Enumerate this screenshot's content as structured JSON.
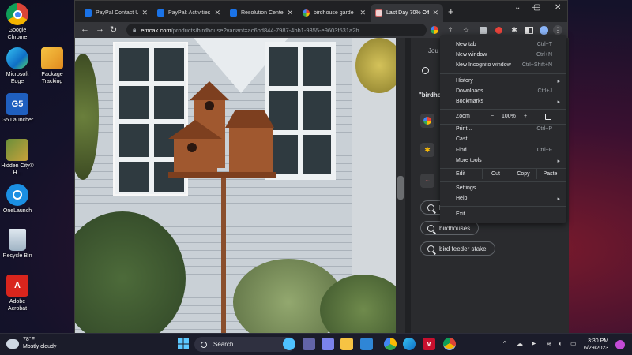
{
  "desktop": {
    "icons": [
      {
        "label": "Google Chrome",
        "icon": "chrome-icon"
      },
      {
        "label": "Microsoft Edge",
        "icon": "edge-icon"
      },
      {
        "label": "G5 Launcher",
        "icon": "g5-launcher-icon"
      },
      {
        "label": "Hidden City® H...",
        "icon": "hidden-city-icon"
      },
      {
        "label": "OneLaunch",
        "icon": "onelaunch-icon"
      },
      {
        "label": "Recycle Bin",
        "icon": "recycle-bin-icon"
      },
      {
        "label": "Adobe Acrobat",
        "icon": "acrobat-icon"
      },
      {
        "label": "Package Tracking",
        "icon": "package-tracking-icon"
      }
    ]
  },
  "browser": {
    "tabs": [
      {
        "title": "PayPal Contact Us",
        "icon": "paypal-icon"
      },
      {
        "title": "PayPal: Activities",
        "icon": "paypal-icon"
      },
      {
        "title": "Resolution Center",
        "icon": "paypal-icon"
      },
      {
        "title": "birdhouse garde",
        "icon": "google-icon"
      },
      {
        "title": "Last Day 70% Off",
        "icon": "site-icon"
      }
    ],
    "url_host": "emcak.com",
    "url_rest": "/products/birdhouse?variant=ac6bd844-7987-4bb1-9355-e9603f531a2b",
    "window_controls": {
      "minimize": "—",
      "maximize": "▢",
      "close": "✕"
    }
  },
  "side_panel": {
    "header_text": "Jou",
    "query_text": "\"birdho",
    "suggestions": [
      "b",
      "birdhouses",
      "bird feeder stake"
    ]
  },
  "menu": {
    "items": [
      {
        "label": "New tab",
        "shortcut": "Ctrl+T"
      },
      {
        "label": "New window",
        "shortcut": "Ctrl+N"
      },
      {
        "label": "New Incognito window",
        "shortcut": "Ctrl+Shift+N"
      },
      {
        "label": "History",
        "shortcut": ""
      },
      {
        "label": "Downloads",
        "shortcut": "Ctrl+J"
      },
      {
        "label": "Bookmarks",
        "shortcut": ""
      }
    ],
    "zoom": {
      "label": "Zoom",
      "minus": "−",
      "value": "100%",
      "plus": "+"
    },
    "items2": [
      {
        "label": "Print...",
        "shortcut": "Ctrl+P"
      },
      {
        "label": "Cast...",
        "shortcut": ""
      },
      {
        "label": "Find...",
        "shortcut": "Ctrl+F"
      },
      {
        "label": "More tools",
        "shortcut": ""
      }
    ],
    "edit": {
      "label": "Edit",
      "cut": "Cut",
      "copy": "Copy",
      "paste": "Paste"
    },
    "items3": [
      {
        "label": "Settings"
      },
      {
        "label": "Help"
      }
    ],
    "exit": "Exit"
  },
  "taskbar": {
    "weather_temp": "78°F",
    "weather_desc": "Mostly cloudy",
    "search_label": "Search",
    "time": "3:30 PM",
    "date": "6/29/2023"
  },
  "colors": {
    "accent": "#8ab4f8",
    "chrome_dark": "#202124",
    "menu_bg": "#292a2d"
  }
}
